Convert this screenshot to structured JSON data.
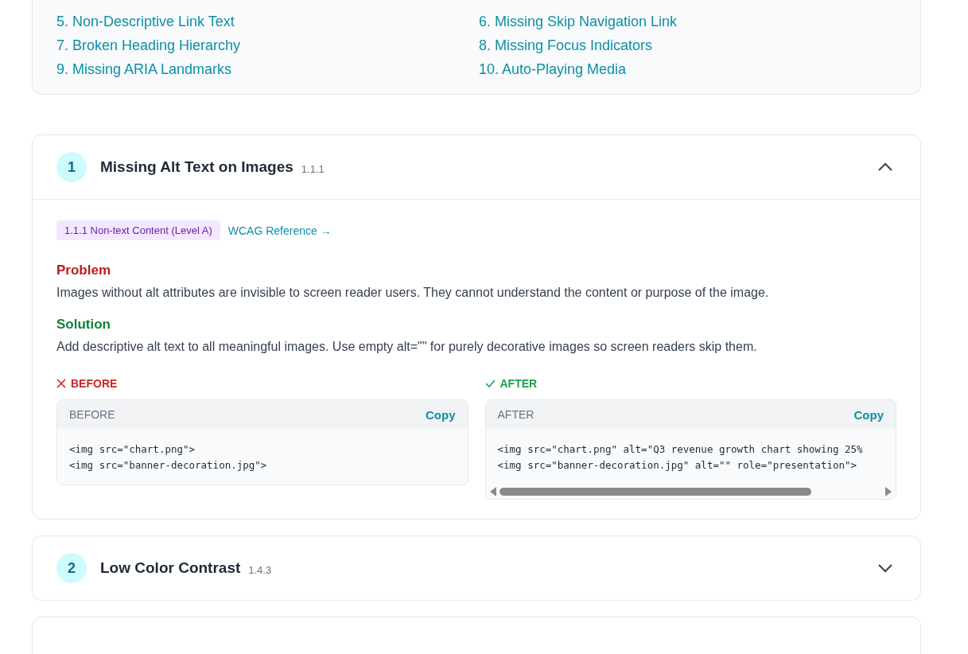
{
  "toc": {
    "items": [
      {
        "label": "5. Non-Descriptive Link Text"
      },
      {
        "label": "6. Missing Skip Navigation Link"
      },
      {
        "label": "7. Broken Heading Hierarchy"
      },
      {
        "label": "8. Missing Focus Indicators"
      },
      {
        "label": "9. Missing ARIA Landmarks"
      },
      {
        "label": "10. Auto-Playing Media"
      }
    ]
  },
  "issues": [
    {
      "number": "1",
      "title": "Missing Alt Text on Images",
      "criterion": "1.1.1",
      "expanded": true,
      "tag": "1.1.1 Non-text Content (Level A)",
      "reference_link": "WCAG Reference →",
      "sections": [
        {
          "kind": "problem",
          "heading": "Problem",
          "text": "Images without alt attributes are invisible to screen reader users. They cannot understand the content or purpose of the image."
        },
        {
          "kind": "solution",
          "heading": "Solution",
          "text": "Add descriptive alt text to all meaningful images. Use empty alt=\"\" for purely decorative images so screen readers skip them."
        }
      ],
      "examples": [
        {
          "kind": "before",
          "label": "BEFORE",
          "box_title": "BEFORE",
          "copy": "Copy",
          "scrollbar": false,
          "code": [
            "<img src=\"chart.png\">",
            "<img src=\"banner-decoration.jpg\">"
          ]
        },
        {
          "kind": "after",
          "label": "AFTER",
          "box_title": "AFTER",
          "copy": "Copy",
          "scrollbar": true,
          "code": [
            "<img src=\"chart.png\" alt=\"Q3 revenue growth chart showing 25%",
            "<img src=\"banner-decoration.jpg\" alt=\"\" role=\"presentation\">"
          ]
        }
      ]
    },
    {
      "number": "2",
      "title": "Low Color Contrast",
      "criterion": "1.4.3",
      "expanded": false
    }
  ]
}
